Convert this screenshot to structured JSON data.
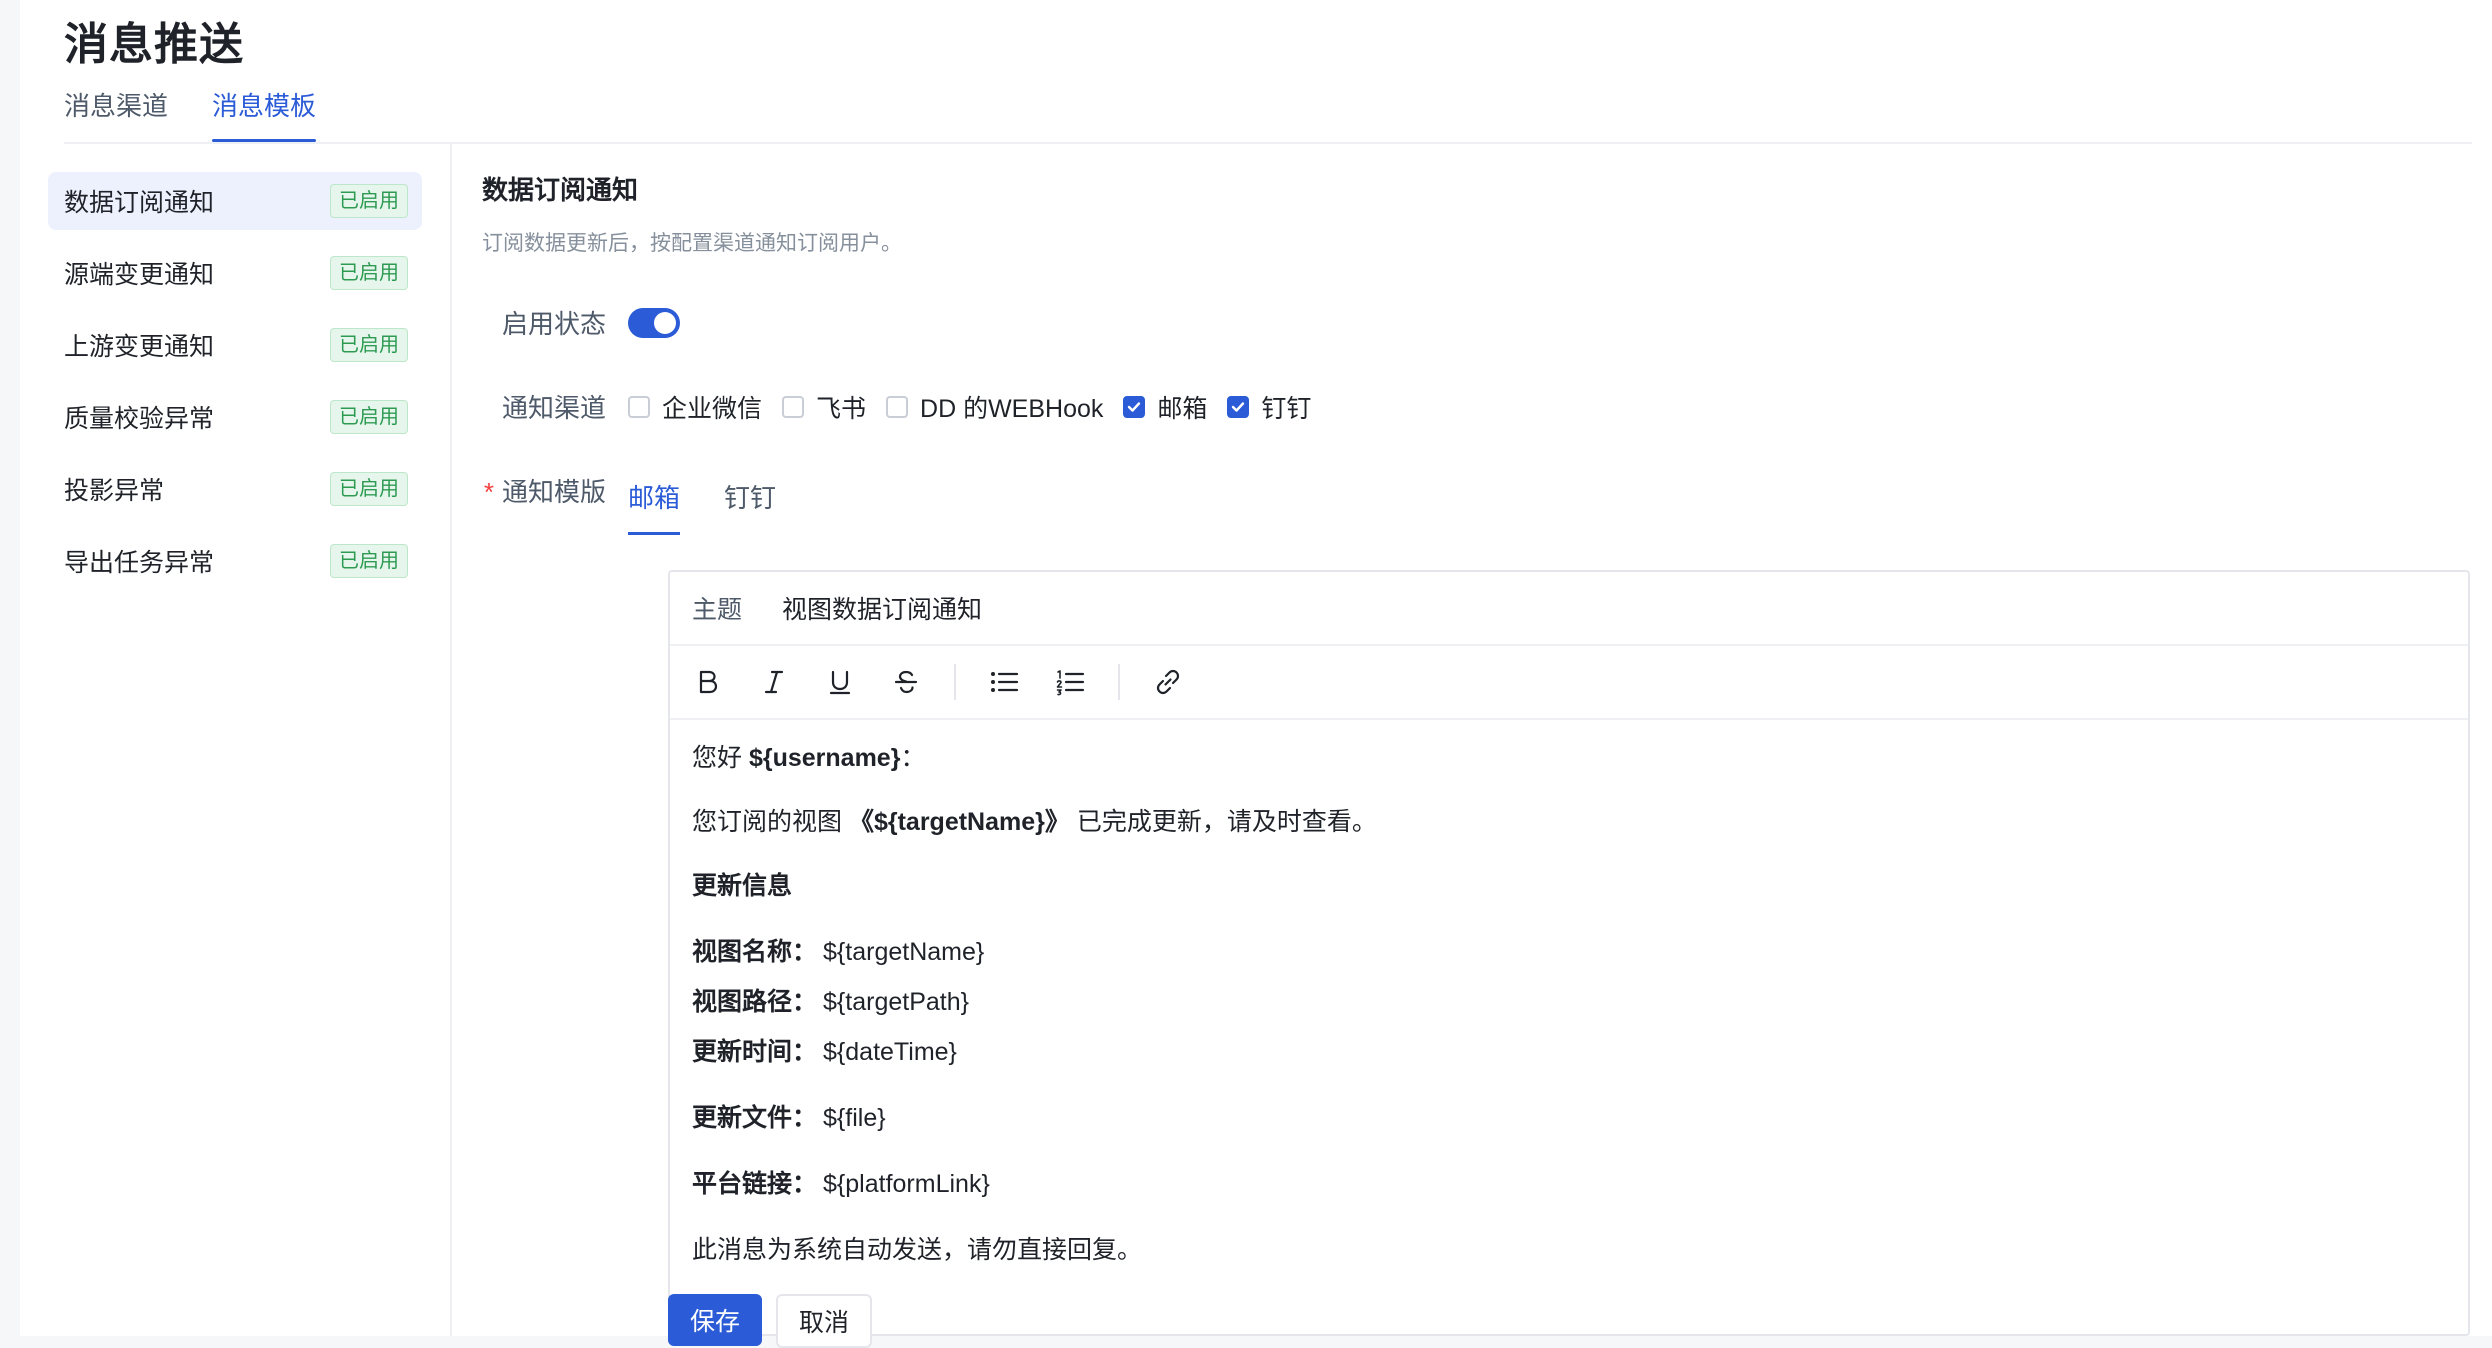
{
  "page": {
    "title": "消息推送"
  },
  "top_tabs": [
    {
      "label": "消息渠道",
      "active": false
    },
    {
      "label": "消息模板",
      "active": true
    }
  ],
  "sidebar": {
    "items": [
      {
        "label": "数据订阅通知",
        "status": "已启用",
        "active": true
      },
      {
        "label": "源端变更通知",
        "status": "已启用",
        "active": false
      },
      {
        "label": "上游变更通知",
        "status": "已启用",
        "active": false
      },
      {
        "label": "质量校验异常",
        "status": "已启用",
        "active": false
      },
      {
        "label": "投影异常",
        "status": "已启用",
        "active": false
      },
      {
        "label": "导出任务异常",
        "status": "已启用",
        "active": false
      }
    ]
  },
  "detail": {
    "title": "数据订阅通知",
    "description": "订阅数据更新后，按配置渠道通知订阅用户。",
    "enable_label": "启用状态",
    "enabled": true,
    "channel_label": "通知渠道",
    "channels": [
      {
        "label": "企业微信",
        "checked": false
      },
      {
        "label": "飞书",
        "checked": false
      },
      {
        "label": "DD 的WEBHook",
        "checked": false
      },
      {
        "label": "邮箱",
        "checked": true
      },
      {
        "label": "钉钉",
        "checked": true
      }
    ],
    "template_label": "通知模版",
    "required_mark": "*",
    "template_tabs": [
      {
        "label": "邮箱",
        "active": true
      },
      {
        "label": "钉钉",
        "active": false
      }
    ]
  },
  "editor": {
    "subject_label": "主题",
    "subject_value": "视图数据订阅通知",
    "toolbar": [
      "bold-icon",
      "italic-icon",
      "underline-icon",
      "strikethrough-icon",
      "bullet-list-icon",
      "ordered-list-icon",
      "link-icon"
    ],
    "greeting_prefix": "您好 ",
    "greeting_var": "${username}",
    "greeting_suffix": "：",
    "line2_prefix": "您订阅的视图 ",
    "line2_var": "《${targetName}》",
    "line2_suffix": " 已完成更新，请及时查看。",
    "section_heading": "更新信息",
    "fields": [
      {
        "label": "视图名称：",
        "value": "${targetName}"
      },
      {
        "label": "视图路径：",
        "value": "${targetPath}"
      },
      {
        "label": "更新时间：",
        "value": "${dateTime}"
      },
      {
        "label": "更新文件：",
        "value": "${file}"
      },
      {
        "label": "平台链接：",
        "value": "${platformLink}"
      }
    ],
    "footer_note": "此消息为系统自动发送，请勿直接回复。"
  },
  "actions": {
    "save": "保存",
    "cancel": "取消"
  },
  "colors": {
    "primary": "#2b5bd7",
    "success": "#2e9b53",
    "required": "#f53f3f"
  }
}
